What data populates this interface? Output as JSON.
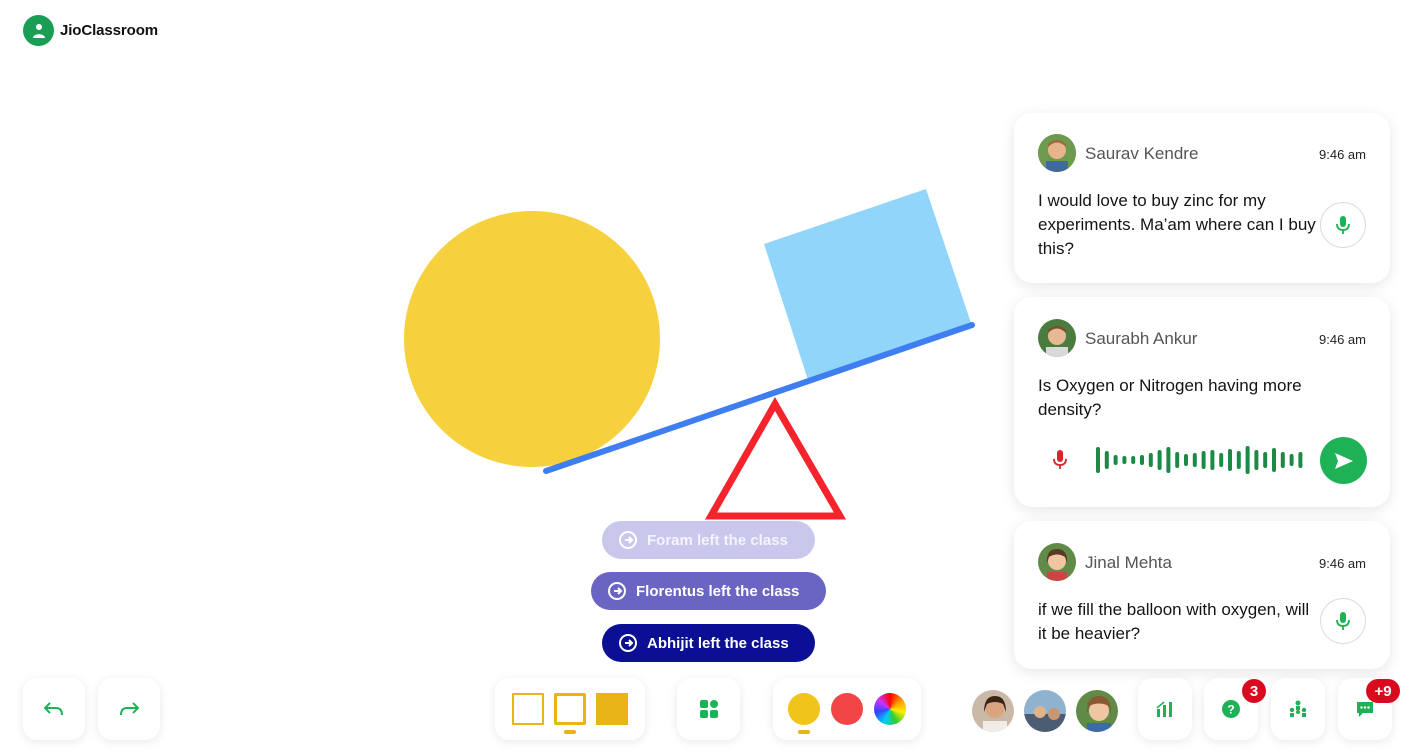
{
  "app": {
    "title": "JioClassroom",
    "brand_color": "#1a9e55"
  },
  "toasts": [
    {
      "text": "Foram left the class",
      "bg": "#c9c8ec"
    },
    {
      "text": "Florentus left the class",
      "bg": "#6a65c2"
    },
    {
      "text": "Abhijit left the class",
      "bg": "#0b0f93"
    }
  ],
  "chat": [
    {
      "name": "Saurav Kendre",
      "time": "9:46 am",
      "message": "I would love to buy zinc for my experiments. Ma’am where can I buy this?"
    },
    {
      "name": "Saurabh Ankur",
      "time": "9:46 am",
      "message": "Is Oxygen or Nitrogen having more density?"
    },
    {
      "name": "Jinal Mehta",
      "time": "9:46 am",
      "message": "if we fill the balloon with oxygen, will it be heavier?"
    }
  ],
  "toolbar": {
    "colors": [
      "#f0c419",
      "#f24646",
      "rainbow"
    ],
    "questions_badge": "3",
    "chat_badge": "+9"
  },
  "icons": {
    "undo": "undo-icon",
    "redo": "redo-icon",
    "shapes": "shapes-icon",
    "stats": "bar-chart-icon",
    "questions": "question-icon",
    "participants": "group-icon",
    "chat": "chat-icon",
    "mic": "mic-icon",
    "send": "send-icon"
  }
}
